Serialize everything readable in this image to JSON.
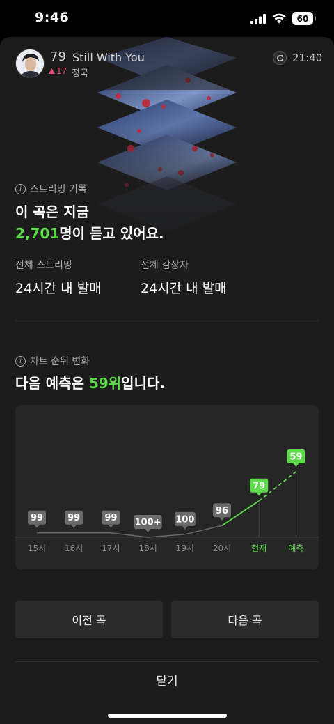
{
  "status_bar": {
    "time": "9:46",
    "battery": "60"
  },
  "header": {
    "rank": "79",
    "title": "Still With You",
    "rank_change": "17",
    "artist": "정국",
    "update_time": "21:40"
  },
  "streaming": {
    "section_label": "스트리밍 기록",
    "headline_line1": "이 곡은 지금",
    "listener_count": "2,701",
    "headline_line2_suffix": "명이 듣고 있어요.",
    "total_streams_label": "전체 스트리밍",
    "total_streams_value": "24시간 내 발매",
    "total_listeners_label": "전체 감상자",
    "total_listeners_value": "24시간 내 발매"
  },
  "rank_change_section": {
    "section_label": "차트 순위 변화",
    "prediction_prefix": "다음 예측은 ",
    "prediction_rank": "59위",
    "prediction_suffix": "입니다."
  },
  "colors": {
    "accent_green": "#5ddb4a",
    "rank_up_red": "#e2506f",
    "badge_gray": "#6b6b6b"
  },
  "chart_data": {
    "type": "line",
    "categories": [
      "15시",
      "16시",
      "17시",
      "18시",
      "19시",
      "20시",
      "현재",
      "예측"
    ],
    "badges": [
      "99",
      "99",
      "99",
      "100+",
      "100",
      "96",
      "79",
      "59"
    ],
    "values": [
      101,
      101,
      101,
      104,
      102,
      96,
      79,
      59
    ],
    "highlighted_categories": [
      "현재",
      "예측"
    ],
    "predicted_index": 7,
    "y_inverted": true,
    "grid": false
  },
  "buttons": {
    "prev": "이전 곡",
    "next": "다음 곡",
    "close": "닫기"
  }
}
